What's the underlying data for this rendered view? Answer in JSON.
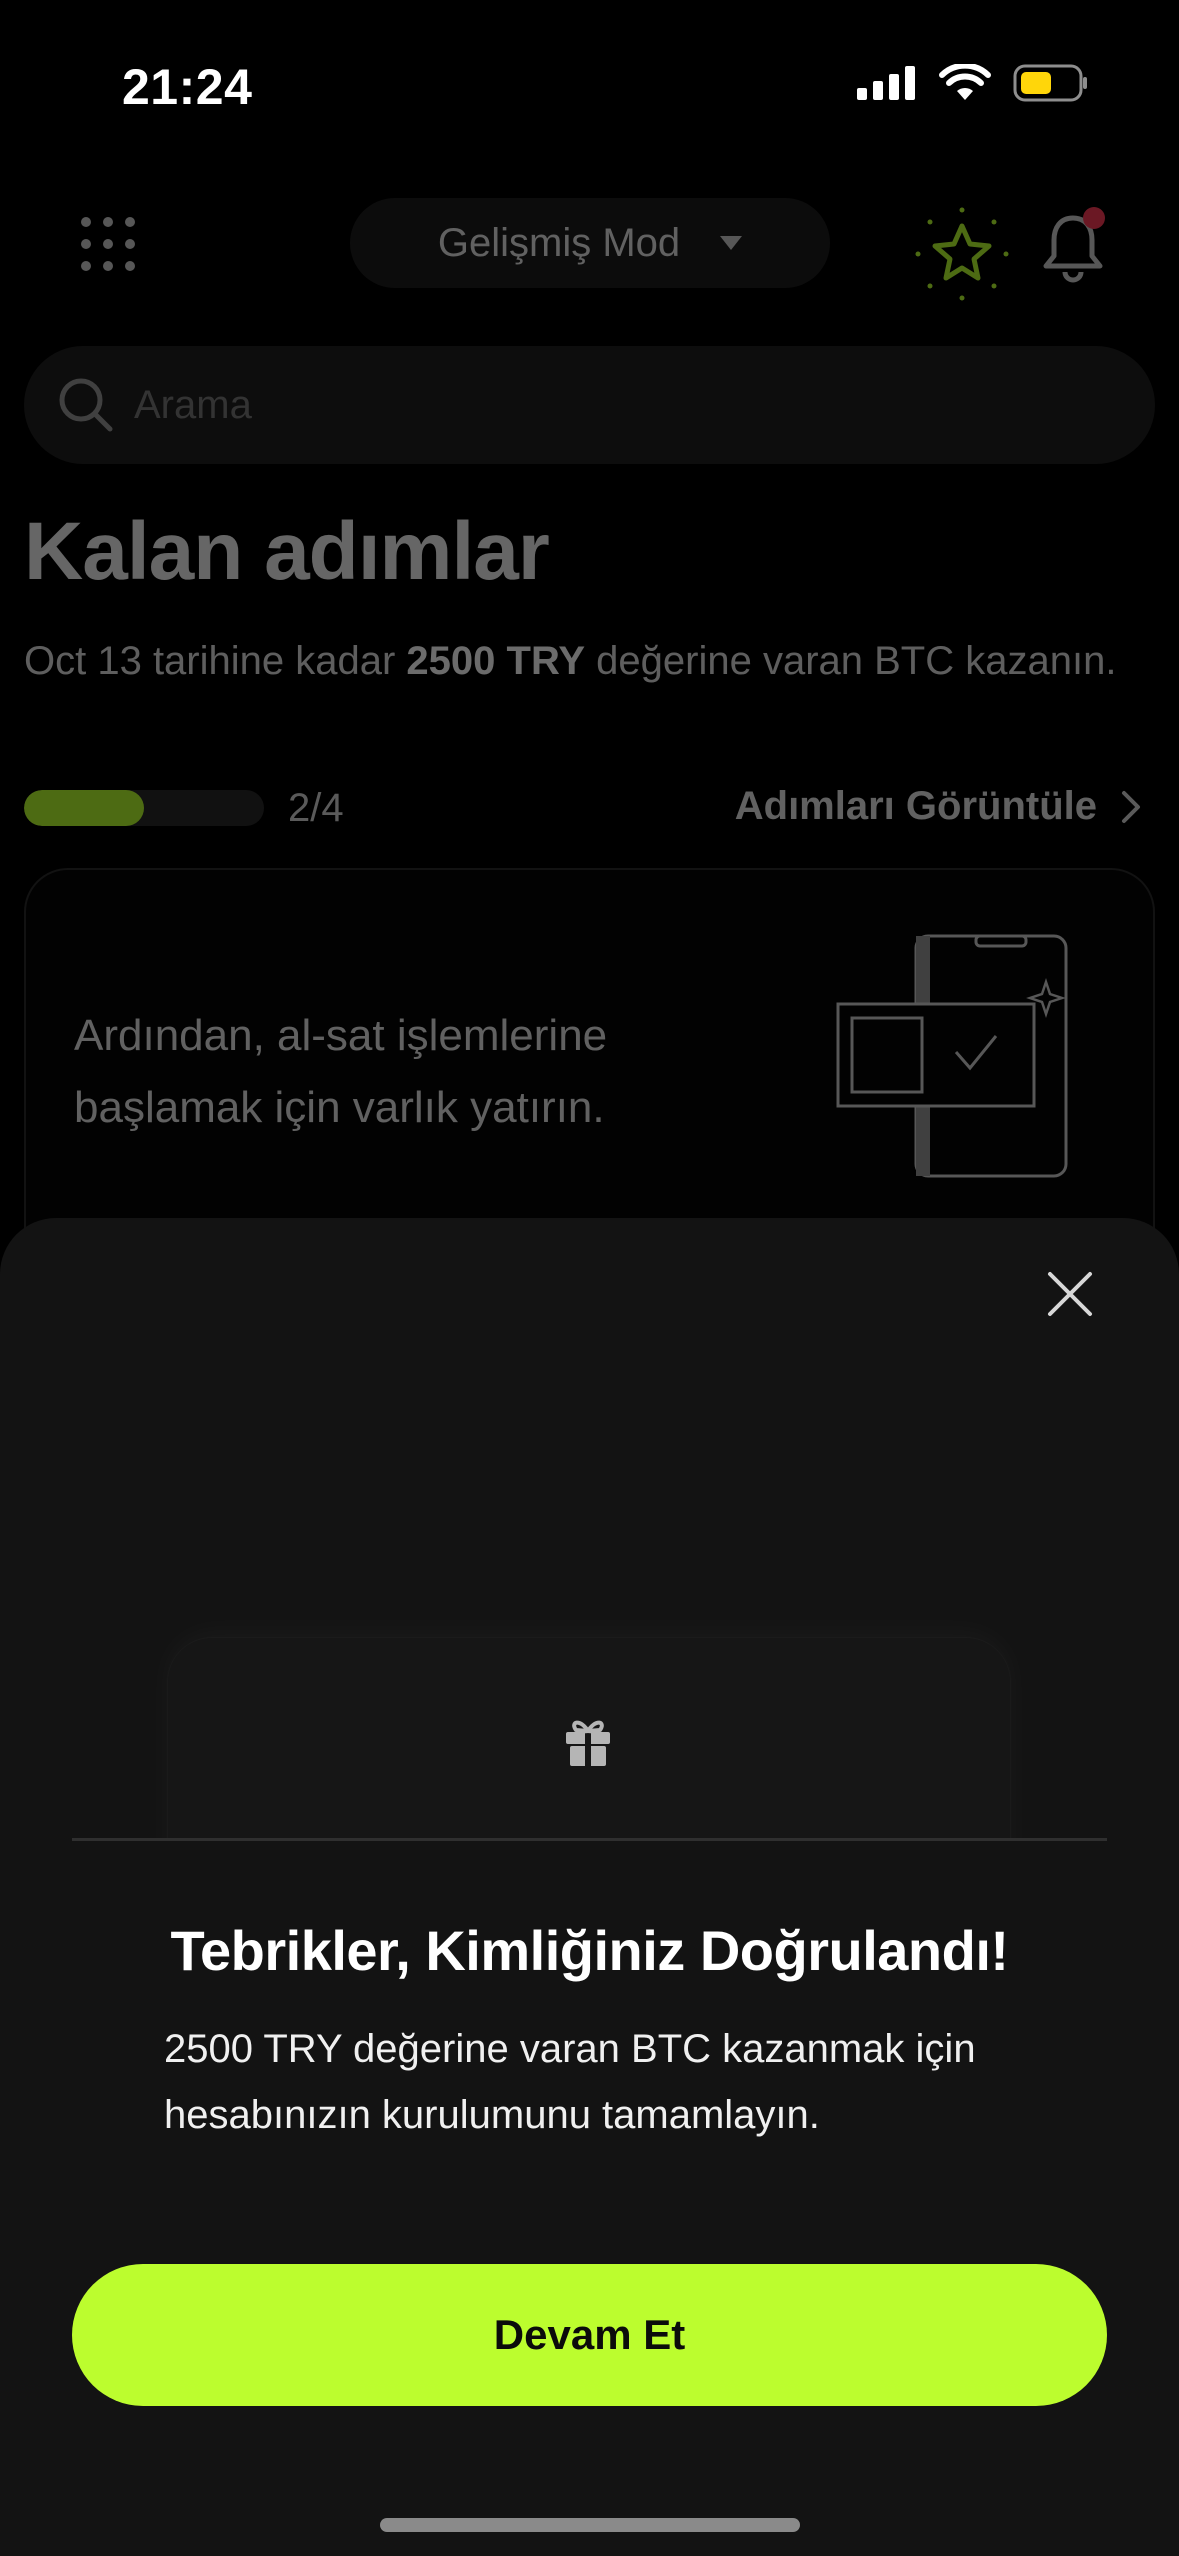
{
  "status_bar": {
    "time": "21:24",
    "icons": [
      "cellular-signal-icon",
      "wifi-icon",
      "battery-icon"
    ],
    "battery_color": "#ffd60a"
  },
  "header": {
    "mode_label": "Gelişmiş Mod",
    "icons": [
      "apps-grid-icon",
      "chevron-down-icon",
      "star-icon",
      "bell-icon"
    ],
    "star_color": "#b7ff2e",
    "notification_dot_color": "#ff3b57"
  },
  "search": {
    "placeholder": "Arama"
  },
  "steps": {
    "title": "Kalan adımlar",
    "desc_prefix": "Oct 13 tarihine kadar ",
    "desc_bold": "2500 TRY",
    "desc_suffix": " değerine varan BTC kazanın.",
    "progress_label": "2/4",
    "progress_fraction": 0.5,
    "view_steps_label": "Adımları Görüntüle"
  },
  "deposit_card": {
    "text": "Ardından, al-sat işlemlerine başlamak için varlık yatırın."
  },
  "sheet": {
    "title": "Tebrikler, Kimliğiniz Doğrulandı!",
    "description": "2500 TRY değerine varan BTC kazanmak için hesabınızın kurulumunu tamamlayın.",
    "button_label": "Devam Et",
    "icons": [
      "close-icon",
      "gift-icon"
    ],
    "accent_color": "#bcfd2e"
  }
}
